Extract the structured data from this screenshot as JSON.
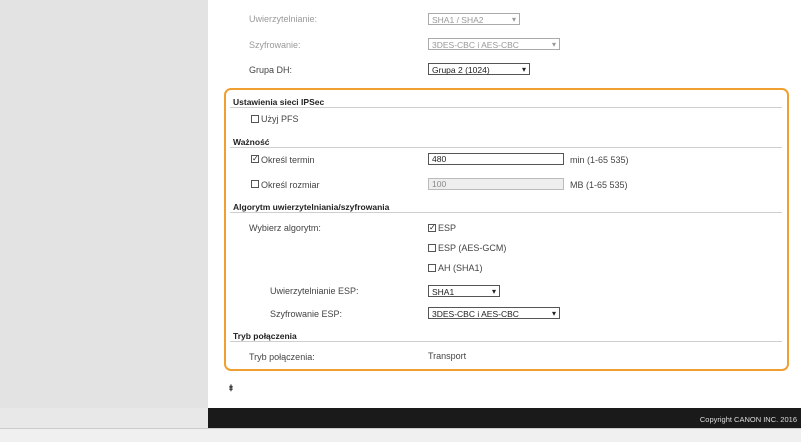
{
  "top": {
    "auth_label": "Uwierzytelnianie:",
    "auth_value": "SHA1 / SHA2",
    "encryption_label": "Szyfrowanie:",
    "encryption_value": "3DES-CBC i AES-CBC",
    "dh_label": "Grupa DH:",
    "dh_value": "Grupa 2 (1024)"
  },
  "ipsec": {
    "title": "Ustawienia sieci IPSec",
    "pfs_label": "Użyj PFS",
    "pfs_checked": false
  },
  "validity": {
    "title": "Ważność",
    "time_label": "Określ termin",
    "time_checked": true,
    "time_value": "480",
    "time_unit": "min (1-65 535)",
    "size_label": "Określ rozmiar",
    "size_checked": false,
    "size_value": "100",
    "size_unit": "MB (1-65 535)"
  },
  "algorithm": {
    "title": "Algorytm uwierzytelniania/szyfrowania",
    "choose_label": "Wybierz algorytm:",
    "options": [
      {
        "label": "ESP",
        "checked": true
      },
      {
        "label": "ESP (AES-GCM)",
        "checked": false
      },
      {
        "label": "AH (SHA1)",
        "checked": false
      }
    ],
    "esp_auth_label": "Uwierzytelnianie ESP:",
    "esp_auth_value": "SHA1",
    "esp_enc_label": "Szyfrowanie ESP:",
    "esp_enc_value": "3DES-CBC i AES-CBC"
  },
  "connection": {
    "title": "Tryb połączenia",
    "label": "Tryb połączenia:",
    "value": "Transport"
  },
  "footer": {
    "copyright": "Copyright CANON INC. 2016"
  },
  "icons": {
    "checkbox_checked": "✓",
    "dropdown": "chevron-down-icon",
    "top_link": "to-top-icon"
  }
}
